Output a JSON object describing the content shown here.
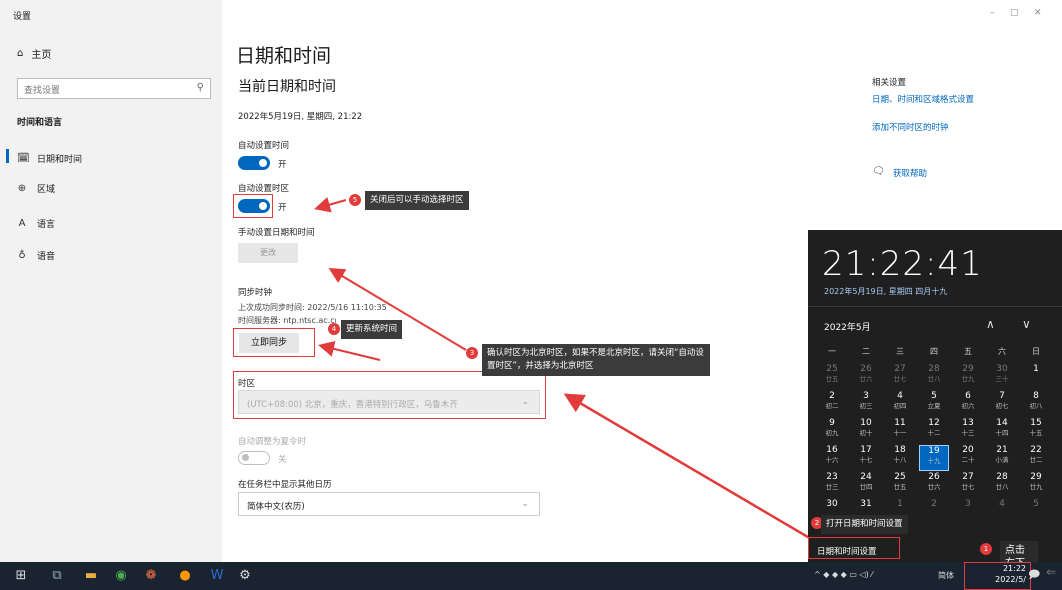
{
  "window": {
    "title": "设置",
    "controls": [
      "–",
      "▢",
      "✕"
    ]
  },
  "nav": {
    "home_label": "主页",
    "search_placeholder": "查找设置",
    "section": "时间和语言",
    "items": [
      {
        "label": "日期和时间",
        "icon": "calendar-clock-icon"
      },
      {
        "label": "区域",
        "icon": "globe-icon"
      },
      {
        "label": "语言",
        "icon": "language-icon"
      },
      {
        "label": "语音",
        "icon": "microphone-icon"
      }
    ]
  },
  "main": {
    "title": "日期和时间",
    "subtitle": "当前日期和时间",
    "current_datetime": "2022年5月19日, 星期四, 21:22",
    "auto_time": {
      "label": "自动设置时间",
      "state": "开"
    },
    "auto_zone": {
      "label": "自动设置时区",
      "state": "开"
    },
    "manual": {
      "label": "手动设置日期和时间",
      "button": "更改"
    },
    "sync": {
      "heading": "同步时钟",
      "last_sync": "上次成功同步时间: 2022/5/16 11:10:35",
      "server": "时间服务器: ntp.ntsc.ac.cn",
      "button": "立即同步"
    },
    "timezone": {
      "label": "时区",
      "value": "(UTC+08:00) 北京，重庆，香港特别行政区，乌鲁木齐"
    },
    "dst": {
      "label": "自动调整为夏令时",
      "state": "关"
    },
    "calendar": {
      "label": "在任务栏中显示其他日历",
      "value": "简体中文(农历)"
    }
  },
  "related": {
    "heading": "相关设置",
    "links": [
      "日期、时间和区域格式设置",
      "添加不同时区的时钟"
    ],
    "help": "获取帮助"
  },
  "annotations": {
    "a1": {
      "num": "1",
      "text": "点击右下角时间"
    },
    "a2": {
      "num": "2",
      "text": "打开日期和时间设置"
    },
    "a3": {
      "num": "3",
      "text": "确认时区为北京时区，如果不是北京时区，请关闭“自动设置时区”，并选择为北京时区"
    },
    "a4": {
      "num": "4",
      "text": "更新系统时间"
    },
    "a5": {
      "num": "5",
      "text": "关闭后可以手动选择时区"
    }
  },
  "flyout": {
    "time": "21:22:41",
    "date": "2022年5月19日, 星期四 四月十九",
    "month": "2022年5月",
    "weekdays": [
      "一",
      "二",
      "三",
      "四",
      "五",
      "六",
      "日"
    ],
    "weeks": [
      [
        [
          "25",
          "廿五",
          1
        ],
        [
          "26",
          "廿六",
          1
        ],
        [
          "27",
          "廿七",
          1
        ],
        [
          "28",
          "廿八",
          1
        ],
        [
          "29",
          "廿九",
          1
        ],
        [
          "30",
          "三十",
          1
        ],
        [
          "1",
          "",
          0
        ]
      ],
      [
        [
          "2",
          "初二",
          0
        ],
        [
          "3",
          "初三",
          0
        ],
        [
          "4",
          "初四",
          0
        ],
        [
          "5",
          "立夏",
          0
        ],
        [
          "6",
          "初六",
          0
        ],
        [
          "7",
          "初七",
          0
        ],
        [
          "8",
          "初八",
          0
        ]
      ],
      [
        [
          "9",
          "初九",
          0
        ],
        [
          "10",
          "初十",
          0
        ],
        [
          "11",
          "十一",
          0
        ],
        [
          "12",
          "十二",
          0
        ],
        [
          "13",
          "十三",
          0
        ],
        [
          "14",
          "十四",
          0
        ],
        [
          "15",
          "十五",
          0
        ]
      ],
      [
        [
          "16",
          "十六",
          0
        ],
        [
          "17",
          "十七",
          0
        ],
        [
          "18",
          "十八",
          0
        ],
        [
          "19",
          "十九",
          0
        ],
        [
          "20",
          "二十",
          0
        ],
        [
          "21",
          "小满",
          0
        ],
        [
          "22",
          "廿二",
          0
        ]
      ],
      [
        [
          "23",
          "廿三",
          0
        ],
        [
          "24",
          "廿四",
          0
        ],
        [
          "25",
          "廿五",
          0
        ],
        [
          "26",
          "廿六",
          0
        ],
        [
          "27",
          "廿七",
          0
        ],
        [
          "28",
          "廿八",
          0
        ],
        [
          "29",
          "廿九",
          0
        ]
      ],
      [
        [
          "30",
          "",
          0
        ],
        [
          "31",
          "",
          0
        ],
        [
          "1",
          "",
          1
        ],
        [
          "2",
          "",
          1
        ],
        [
          "3",
          "",
          1
        ],
        [
          "4",
          "",
          1
        ],
        [
          "5",
          "",
          1
        ]
      ]
    ],
    "today": "19",
    "settings_link": "日期和时间设置"
  },
  "taskbar": {
    "time": "21:22",
    "date": "2022/5/",
    "ime": "简体"
  }
}
